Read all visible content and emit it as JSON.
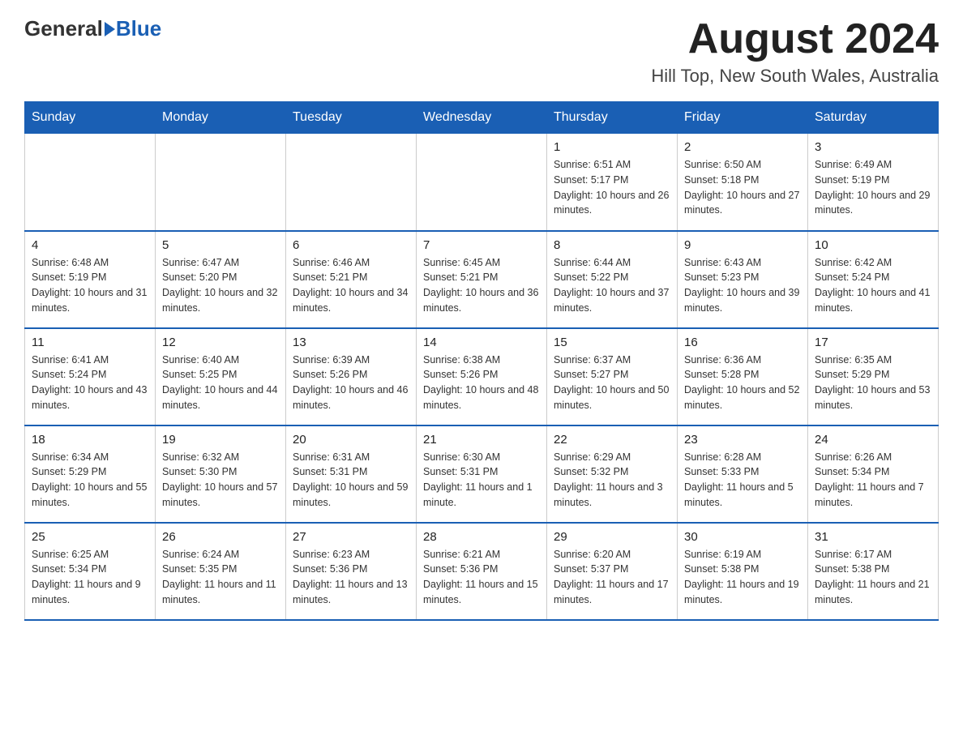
{
  "header": {
    "logo_general": "General",
    "logo_blue": "Blue",
    "month_year": "August 2024",
    "location": "Hill Top, New South Wales, Australia"
  },
  "days_of_week": [
    "Sunday",
    "Monday",
    "Tuesday",
    "Wednesday",
    "Thursday",
    "Friday",
    "Saturday"
  ],
  "weeks": [
    [
      {
        "day": "",
        "info": ""
      },
      {
        "day": "",
        "info": ""
      },
      {
        "day": "",
        "info": ""
      },
      {
        "day": "",
        "info": ""
      },
      {
        "day": "1",
        "info": "Sunrise: 6:51 AM\nSunset: 5:17 PM\nDaylight: 10 hours and 26 minutes."
      },
      {
        "day": "2",
        "info": "Sunrise: 6:50 AM\nSunset: 5:18 PM\nDaylight: 10 hours and 27 minutes."
      },
      {
        "day": "3",
        "info": "Sunrise: 6:49 AM\nSunset: 5:19 PM\nDaylight: 10 hours and 29 minutes."
      }
    ],
    [
      {
        "day": "4",
        "info": "Sunrise: 6:48 AM\nSunset: 5:19 PM\nDaylight: 10 hours and 31 minutes."
      },
      {
        "day": "5",
        "info": "Sunrise: 6:47 AM\nSunset: 5:20 PM\nDaylight: 10 hours and 32 minutes."
      },
      {
        "day": "6",
        "info": "Sunrise: 6:46 AM\nSunset: 5:21 PM\nDaylight: 10 hours and 34 minutes."
      },
      {
        "day": "7",
        "info": "Sunrise: 6:45 AM\nSunset: 5:21 PM\nDaylight: 10 hours and 36 minutes."
      },
      {
        "day": "8",
        "info": "Sunrise: 6:44 AM\nSunset: 5:22 PM\nDaylight: 10 hours and 37 minutes."
      },
      {
        "day": "9",
        "info": "Sunrise: 6:43 AM\nSunset: 5:23 PM\nDaylight: 10 hours and 39 minutes."
      },
      {
        "day": "10",
        "info": "Sunrise: 6:42 AM\nSunset: 5:24 PM\nDaylight: 10 hours and 41 minutes."
      }
    ],
    [
      {
        "day": "11",
        "info": "Sunrise: 6:41 AM\nSunset: 5:24 PM\nDaylight: 10 hours and 43 minutes."
      },
      {
        "day": "12",
        "info": "Sunrise: 6:40 AM\nSunset: 5:25 PM\nDaylight: 10 hours and 44 minutes."
      },
      {
        "day": "13",
        "info": "Sunrise: 6:39 AM\nSunset: 5:26 PM\nDaylight: 10 hours and 46 minutes."
      },
      {
        "day": "14",
        "info": "Sunrise: 6:38 AM\nSunset: 5:26 PM\nDaylight: 10 hours and 48 minutes."
      },
      {
        "day": "15",
        "info": "Sunrise: 6:37 AM\nSunset: 5:27 PM\nDaylight: 10 hours and 50 minutes."
      },
      {
        "day": "16",
        "info": "Sunrise: 6:36 AM\nSunset: 5:28 PM\nDaylight: 10 hours and 52 minutes."
      },
      {
        "day": "17",
        "info": "Sunrise: 6:35 AM\nSunset: 5:29 PM\nDaylight: 10 hours and 53 minutes."
      }
    ],
    [
      {
        "day": "18",
        "info": "Sunrise: 6:34 AM\nSunset: 5:29 PM\nDaylight: 10 hours and 55 minutes."
      },
      {
        "day": "19",
        "info": "Sunrise: 6:32 AM\nSunset: 5:30 PM\nDaylight: 10 hours and 57 minutes."
      },
      {
        "day": "20",
        "info": "Sunrise: 6:31 AM\nSunset: 5:31 PM\nDaylight: 10 hours and 59 minutes."
      },
      {
        "day": "21",
        "info": "Sunrise: 6:30 AM\nSunset: 5:31 PM\nDaylight: 11 hours and 1 minute."
      },
      {
        "day": "22",
        "info": "Sunrise: 6:29 AM\nSunset: 5:32 PM\nDaylight: 11 hours and 3 minutes."
      },
      {
        "day": "23",
        "info": "Sunrise: 6:28 AM\nSunset: 5:33 PM\nDaylight: 11 hours and 5 minutes."
      },
      {
        "day": "24",
        "info": "Sunrise: 6:26 AM\nSunset: 5:34 PM\nDaylight: 11 hours and 7 minutes."
      }
    ],
    [
      {
        "day": "25",
        "info": "Sunrise: 6:25 AM\nSunset: 5:34 PM\nDaylight: 11 hours and 9 minutes."
      },
      {
        "day": "26",
        "info": "Sunrise: 6:24 AM\nSunset: 5:35 PM\nDaylight: 11 hours and 11 minutes."
      },
      {
        "day": "27",
        "info": "Sunrise: 6:23 AM\nSunset: 5:36 PM\nDaylight: 11 hours and 13 minutes."
      },
      {
        "day": "28",
        "info": "Sunrise: 6:21 AM\nSunset: 5:36 PM\nDaylight: 11 hours and 15 minutes."
      },
      {
        "day": "29",
        "info": "Sunrise: 6:20 AM\nSunset: 5:37 PM\nDaylight: 11 hours and 17 minutes."
      },
      {
        "day": "30",
        "info": "Sunrise: 6:19 AM\nSunset: 5:38 PM\nDaylight: 11 hours and 19 minutes."
      },
      {
        "day": "31",
        "info": "Sunrise: 6:17 AM\nSunset: 5:38 PM\nDaylight: 11 hours and 21 minutes."
      }
    ]
  ]
}
